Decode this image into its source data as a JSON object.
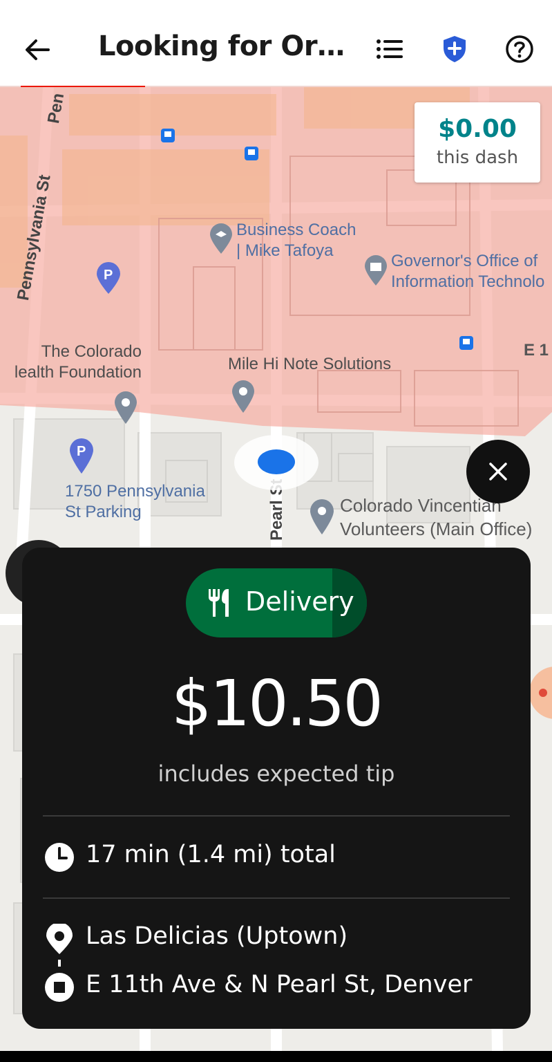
{
  "header": {
    "title": "Looking for Ord...",
    "back_icon": "arrow-left-icon",
    "list_icon": "list-icon",
    "safety_icon": "shield-plus-icon",
    "help_icon": "help-circle-icon",
    "progress": 0.22
  },
  "dash_card": {
    "amount": "$0.00",
    "label": "this dash"
  },
  "map": {
    "streets": {
      "pennsylvania": "Pennsylvania St",
      "penn_partial": "Pen",
      "pearl": "Pearl St"
    },
    "places": {
      "business_coach": "Business Coach\n| Mike Tafoya",
      "governor_office": "Governor's Office of\nInformation Technolo",
      "colorado_health": "The Colorado\nlealth Foundation",
      "mile_hi": "Mile Hi Note Solutions",
      "parking": "1750 Pennsylvania\nSt Parking",
      "vincentian": "Colorado Vincentian\nVolunteers (Main Office)",
      "e1": "E 1"
    },
    "colors": {
      "zone": "#f5a9a0",
      "current_location": "#1a73e8"
    }
  },
  "offer": {
    "type_label": "Delivery",
    "type_icon": "fork-knife-icon",
    "price": "$10.50",
    "price_note": "includes expected tip",
    "duration": "17 min (1.4 mi) total",
    "pickup": "Las Delicias (Uptown)",
    "dropoff": "E 11th Ave & N Pearl St, Denver",
    "colors": {
      "pill": "#006f3c",
      "card": "#151515"
    }
  }
}
